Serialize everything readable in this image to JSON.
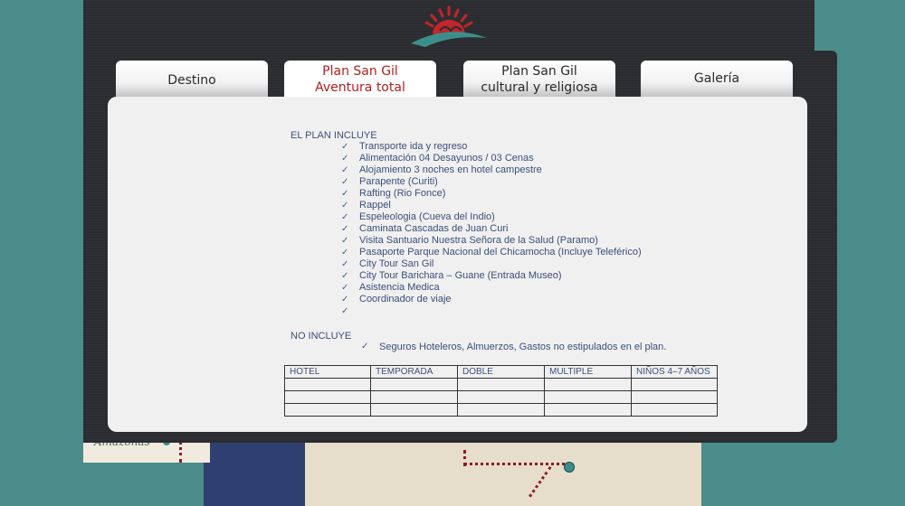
{
  "tabs": [
    {
      "line1": "Destino",
      "line2": ""
    },
    {
      "line1": "Plan San Gil",
      "line2": "Aventura total"
    },
    {
      "line1": "Plan San Gil",
      "line2": "cultural y religiosa"
    },
    {
      "line1": "Galería",
      "line2": ""
    }
  ],
  "map_label": "Amazonas",
  "plan": {
    "includes_heading": "EL PLAN INCLUYE",
    "includes": [
      "Transporte ida y regreso",
      "Alimentación 04 Desayunos / 03 Cenas",
      "Alojamiento 3 noches en hotel campestre",
      "Parapente (Curiti)",
      "Rafting (Rio Fonce)",
      "Rappel",
      "Espeleologia (Cueva del Indio)",
      "Caminata Cascadas de Juan Curi",
      "Visita Santuario Nuestra Señora de la Salud (Paramo)",
      "Pasaporte Parque Nacional del Chicamocha (Incluye Teleférico)",
      "City Tour San Gil",
      "City Tour Barichara – Guane  (Entrada Museo)",
      "Asistencia Medica",
      "Coordinador de viaje",
      ""
    ],
    "excludes_heading": "NO INCLUYE",
    "excludes": "Seguros Hoteleros, Almuerzos, Gastos no estipulados en el plan."
  },
  "rates_table": {
    "headers": [
      "HOTEL",
      "TEMPORADA",
      "DOBLE",
      "MULTIPLE",
      "NIÑOS 4–7 AÑOS"
    ],
    "rows": [
      [
        "",
        "",
        "",
        "",
        ""
      ],
      [
        "",
        "",
        "",
        "",
        ""
      ],
      [
        "",
        "",
        "",
        "",
        ""
      ]
    ]
  },
  "colors": {
    "background": "#4b8d8a",
    "panel": "#2b2c30",
    "active_tab_text": "#b02020",
    "doc_text": "#3b4f7a"
  }
}
